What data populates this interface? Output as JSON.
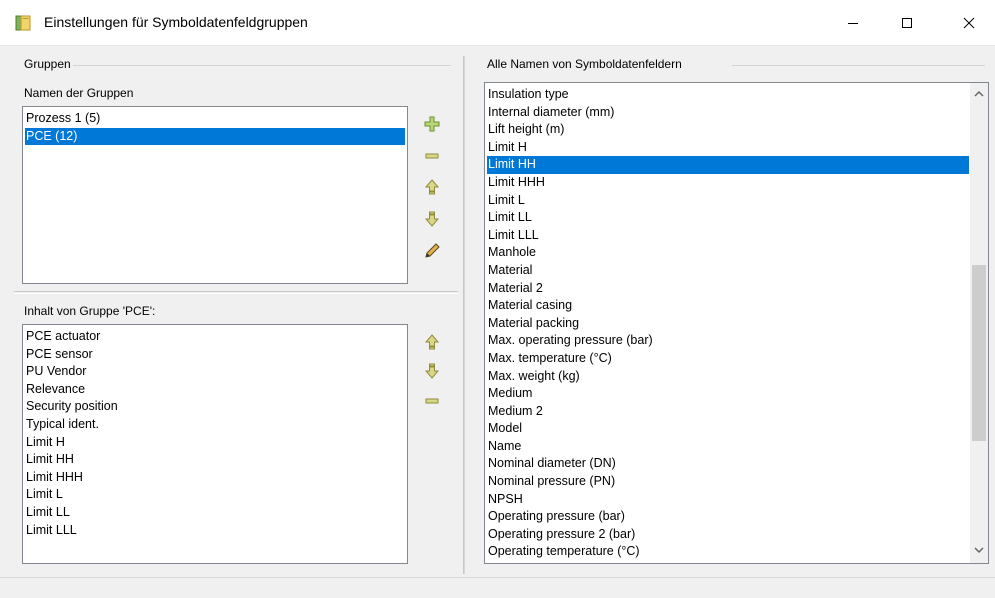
{
  "window": {
    "title": "Einstellungen für Symboldatenfeldgruppen",
    "accent_color": "#0078d7"
  },
  "left_panel": {
    "group_box_label": "Gruppen",
    "groups_list_label": "Namen der Gruppen",
    "groups": [
      {
        "label": "Prozess 1 (5)",
        "selected": false
      },
      {
        "label": "PCE (12)",
        "selected": true
      }
    ],
    "group_tools": [
      "add-icon",
      "remove-icon",
      "move-up-icon",
      "move-down-icon",
      "edit-icon"
    ],
    "content_label": "Inhalt von Gruppe 'PCE':",
    "content_items": [
      "PCE actuator",
      "PCE sensor",
      "PU Vendor",
      "Relevance",
      "Security position",
      "Typical ident.",
      "Limit H",
      "Limit HH",
      "Limit HHH",
      "Limit L",
      "Limit LL",
      "Limit LLL"
    ],
    "content_tools": [
      "move-up-icon",
      "move-down-icon",
      "remove-icon"
    ]
  },
  "right_panel": {
    "group_box_label": "Alle Namen von Symboldatenfeldern",
    "fields": [
      {
        "label": "Insulation type",
        "selected": false
      },
      {
        "label": "Internal diameter (mm)",
        "selected": false
      },
      {
        "label": "Lift height (m)",
        "selected": false
      },
      {
        "label": "Limit H",
        "selected": false
      },
      {
        "label": "Limit HH",
        "selected": true
      },
      {
        "label": "Limit HHH",
        "selected": false
      },
      {
        "label": "Limit L",
        "selected": false
      },
      {
        "label": "Limit LL",
        "selected": false
      },
      {
        "label": "Limit LLL",
        "selected": false
      },
      {
        "label": "Manhole",
        "selected": false
      },
      {
        "label": "Material",
        "selected": false
      },
      {
        "label": "Material 2",
        "selected": false
      },
      {
        "label": "Material casing",
        "selected": false
      },
      {
        "label": "Material packing",
        "selected": false
      },
      {
        "label": "Max. operating pressure (bar)",
        "selected": false
      },
      {
        "label": "Max. temperature (°C)",
        "selected": false
      },
      {
        "label": "Max. weight (kg)",
        "selected": false
      },
      {
        "label": "Medium",
        "selected": false
      },
      {
        "label": "Medium 2",
        "selected": false
      },
      {
        "label": "Model",
        "selected": false
      },
      {
        "label": "Name",
        "selected": false
      },
      {
        "label": "Nominal diameter (DN)",
        "selected": false
      },
      {
        "label": "Nominal pressure (PN)",
        "selected": false
      },
      {
        "label": "NPSH",
        "selected": false
      },
      {
        "label": "Operating pressure (bar)",
        "selected": false
      },
      {
        "label": "Operating pressure 2 (bar)",
        "selected": false
      },
      {
        "label": "Operating temperature (°C)",
        "selected": false
      }
    ]
  }
}
